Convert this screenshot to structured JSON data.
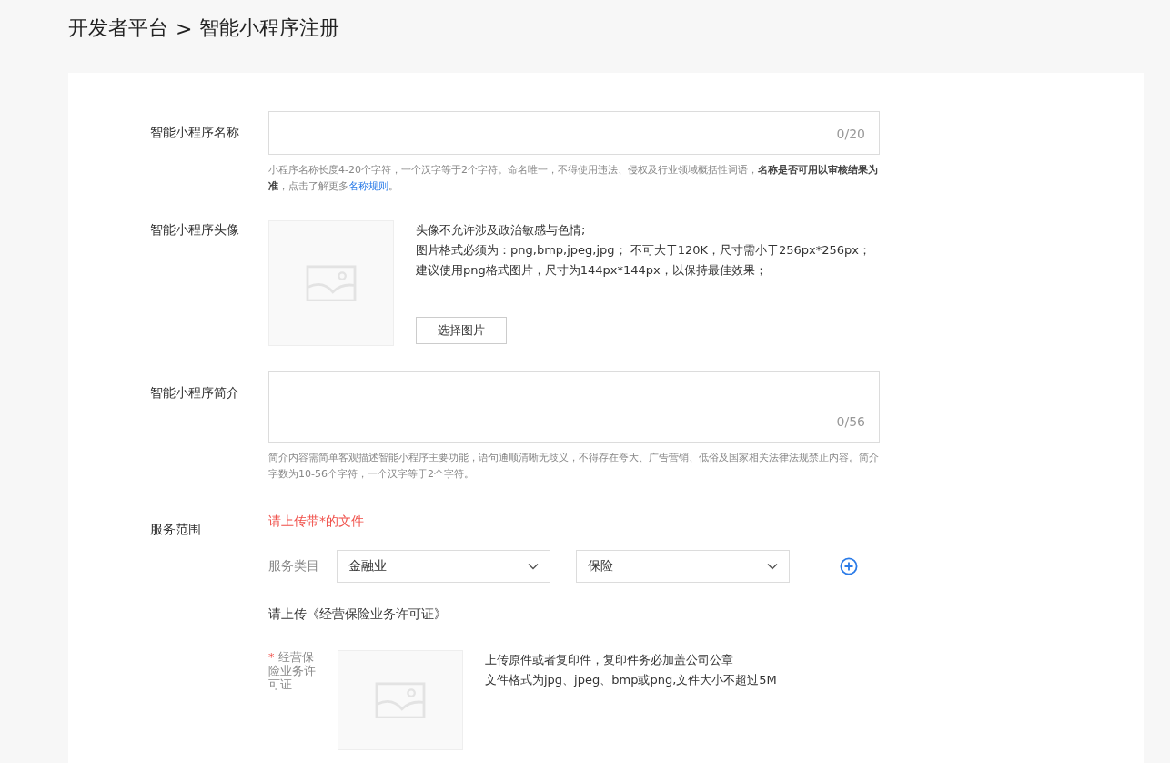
{
  "breadcrumb": {
    "parent": "开发者平台",
    "separator": ">",
    "current": "智能小程序注册"
  },
  "name_field": {
    "label": "智能小程序名称",
    "counter": "0/20",
    "hint": "小程序名称长度4-20个字符，一个汉字等于2个字符。命名唯一，不得使用违法、侵权及行业领域概括性词语，**名称是否可用以审核结果为准**，点击了解更多",
    "hint_link": "名称规则",
    "hint_end": "。"
  },
  "avatar": {
    "label": "智能小程序头像",
    "notes": [
      "头像不允许涉及政治敏感与色情;",
      "图片格式必须为：png,bmp,jpeg,jpg；  不可大于120K，尺寸需小于256px*256px；建议使用png格式图片，尺寸为144px*144px，以保持最佳效果；"
    ],
    "button": "选择图片"
  },
  "intro_field": {
    "label": "智能小程序简介",
    "counter": "0/56",
    "hint": "简介内容需简单客观描述智能小程序主要功能，语句通顺清晰无歧义，不得存在夸大、广告营销、低俗及国家相关法律法规禁止内容。简介字数为10-56个字符，一个汉字等于2个字符。"
  },
  "service": {
    "label": "服务范围",
    "warning": "请上传带*的文件",
    "category_label": "服务类目",
    "selects": [
      "金融业",
      "保险"
    ],
    "upload_title": "请上传《经营保险业务许可证》",
    "license": {
      "required": true,
      "mark": "*",
      "label": "经营保险业务许可证",
      "notes": [
        "上传原件或者复印件，复印件务必加盖公司公章",
        "文件格式为jpg、jpeg、bmp或png,文件大小不超过5M"
      ]
    }
  }
}
